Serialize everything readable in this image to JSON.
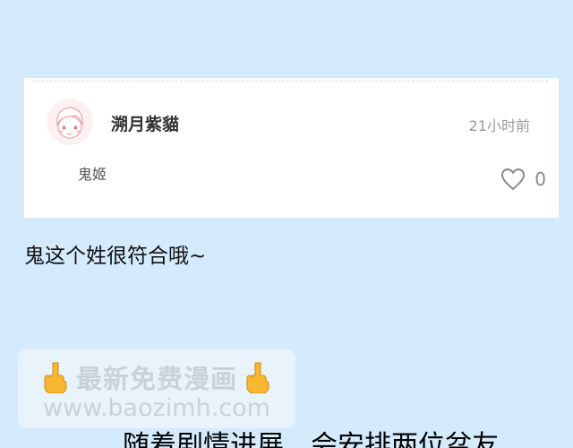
{
  "comment": {
    "username": "溯月紫貓",
    "timestamp": "21小时前",
    "text": "鬼姬",
    "like_count": "0"
  },
  "caption": "鬼这个姓很符合哦~",
  "watermark": {
    "title": "最新免费漫画",
    "url": "www.baozimh.com"
  },
  "bottom_text": "随着剧情进展，会安排两位盆友",
  "colors": {
    "background": "#d4ebfd",
    "card": "#ffffff",
    "watermark_text": "#c9d2db"
  },
  "icons": [
    "avatar-image",
    "heart-icon",
    "pointing-hand-icon"
  ]
}
